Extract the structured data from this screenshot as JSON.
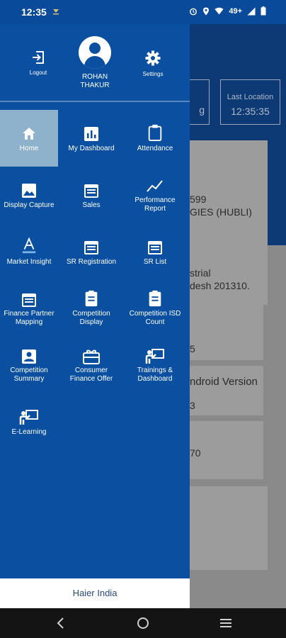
{
  "status_bar": {
    "time": "12:35",
    "network": "49+",
    "icons": [
      "alarm-icon",
      "location-icon",
      "wifi-icon",
      "signal-icon",
      "battery-icon"
    ]
  },
  "drawer": {
    "logout_label": "Logout",
    "settings_label": "Settings",
    "user_name": "ROHAN THAKUR",
    "menu": [
      {
        "label": "Home",
        "icon": "home-icon",
        "active": true
      },
      {
        "label": "My Dashboard",
        "icon": "dashboard-icon",
        "active": false
      },
      {
        "label": "Attendance",
        "icon": "clipboard-icon",
        "active": false
      },
      {
        "label": "Display Capture",
        "icon": "image-icon",
        "active": false
      },
      {
        "label": "Sales",
        "icon": "calendar-icon",
        "active": false
      },
      {
        "label": "Performance Report",
        "icon": "trend-icon",
        "active": false
      },
      {
        "label": "Market Insight",
        "icon": "text-format-icon",
        "active": false
      },
      {
        "label": "SR Registration",
        "icon": "calendar-icon",
        "active": false
      },
      {
        "label": "SR List",
        "icon": "calendar-icon",
        "active": false
      },
      {
        "label": "Finance Partner Mapping",
        "icon": "calendar-icon",
        "active": false
      },
      {
        "label": "Competition Display",
        "icon": "clipboard-icon",
        "active": false
      },
      {
        "label": "Competition ISD Count",
        "icon": "clipboard-icon",
        "active": false
      },
      {
        "label": "Competition Summary",
        "icon": "contact-icon",
        "active": false
      },
      {
        "label": "Consumer Finance Offer",
        "icon": "gift-icon",
        "active": false
      },
      {
        "label": "Trainings & Dashboard",
        "icon": "presenter-icon",
        "active": false
      },
      {
        "label": "E-Learning",
        "icon": "presenter-icon",
        "active": false
      }
    ],
    "brand": "Haier India"
  },
  "background": {
    "box1_value": "g",
    "last_location_label": "Last Location",
    "last_location_value": "12:35:35",
    "card1_line1": "599",
    "card1_line2": "GIES (HUBLI)",
    "card2_line1": "strial",
    "card2_line2": "desh 201310.",
    "card2_line3": "5",
    "card3_text": "ndroid Version",
    "card3_sub": "3",
    "card4_text": "70"
  }
}
